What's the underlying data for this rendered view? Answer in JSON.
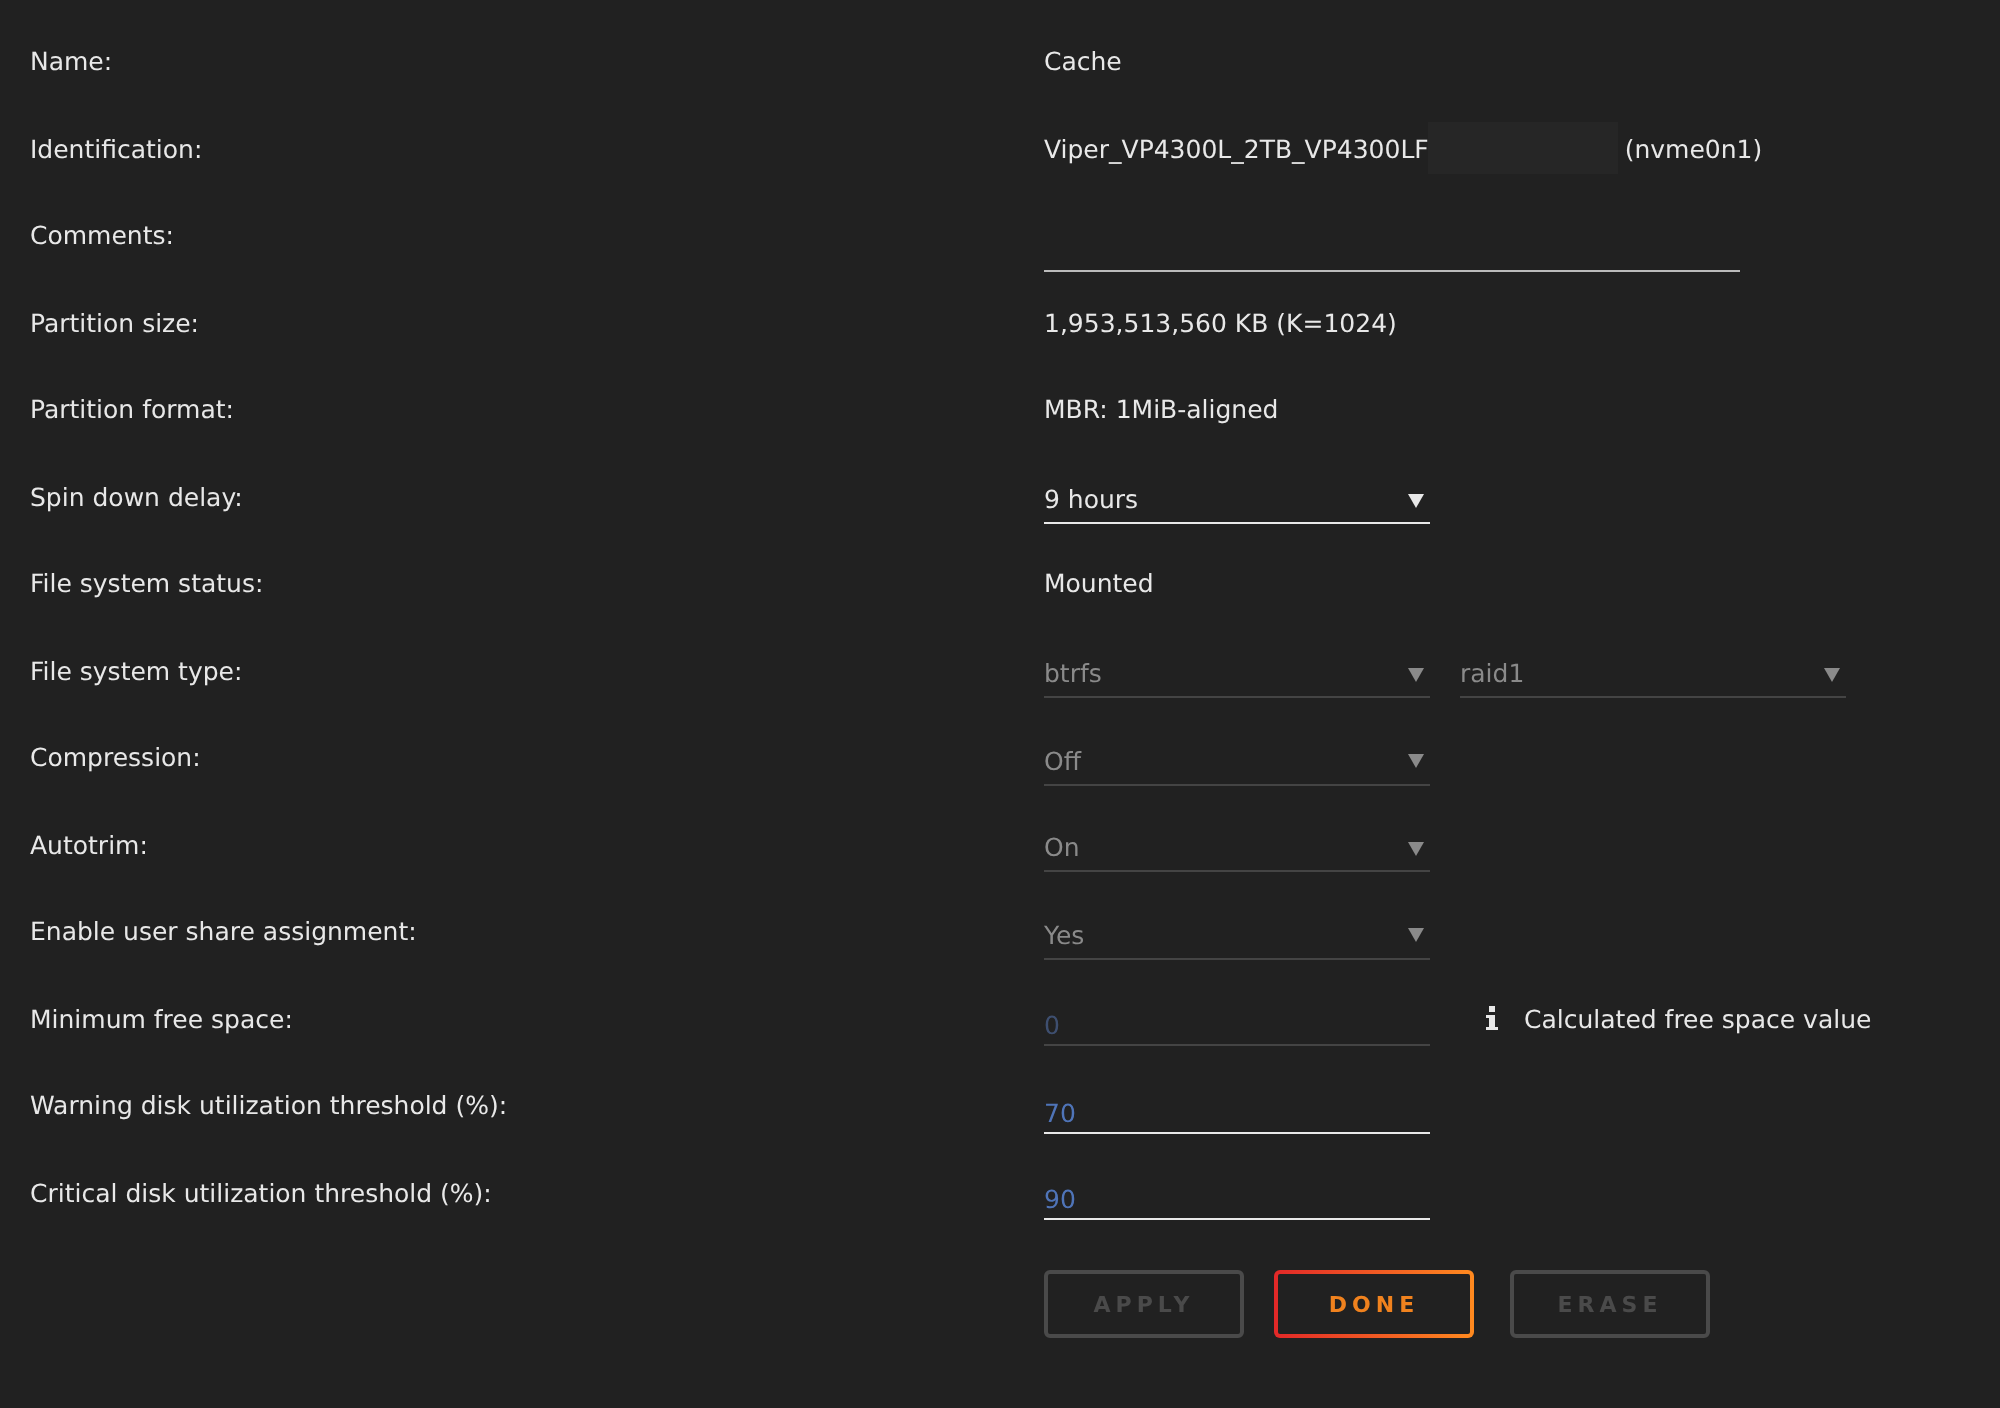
{
  "rows": [
    {
      "label": "Name:",
      "kind": "text",
      "value": "Cache"
    },
    {
      "label": "Identification:",
      "kind": "id",
      "value": "Viper_VP4300L_2TB_VP4300LF",
      "suffix": "(nvme0n1)"
    },
    {
      "label": "Comments:",
      "kind": "input",
      "disabled": false,
      "wide": true
    },
    {
      "label": "Partition size:",
      "kind": "text",
      "value": "1,953,513,560 KB (K=1024)"
    },
    {
      "label": "Partition format:",
      "kind": "text",
      "value": "MBR: 1MiB-aligned"
    },
    {
      "label": "Spin down delay:",
      "kind": "select",
      "selects": [
        {
          "value": "9 hours",
          "disabled": false
        }
      ]
    },
    {
      "label": "File system status:",
      "kind": "text",
      "value": "Mounted"
    },
    {
      "label": "File system type:",
      "kind": "select",
      "selects": [
        {
          "value": "btrfs",
          "disabled": true
        },
        {
          "value": "raid1",
          "disabled": true
        }
      ]
    },
    {
      "label": "Compression:",
      "kind": "select",
      "selects": [
        {
          "value": "Off",
          "disabled": true
        }
      ]
    },
    {
      "label": "Autotrim:",
      "kind": "select",
      "selects": [
        {
          "value": "On",
          "disabled": true
        }
      ]
    },
    {
      "label": "Enable user share assignment:",
      "kind": "select",
      "selects": [
        {
          "value": "Yes",
          "disabled": true
        }
      ]
    },
    {
      "label": "Minimum free space:",
      "kind": "input",
      "value": "0",
      "disabled": true,
      "note": "Calculated free space value"
    },
    {
      "label": "Warning disk utilization threshold (%):",
      "kind": "input",
      "value": "70",
      "disabled": false
    },
    {
      "label": "Critical disk utilization threshold (%):",
      "kind": "input",
      "value": "90",
      "disabled": false
    }
  ],
  "buttons": [
    {
      "label": "APPLY",
      "disabled": true
    },
    {
      "label": "DONE",
      "disabled": false
    },
    {
      "label": "ERASE",
      "disabled": true
    }
  ]
}
